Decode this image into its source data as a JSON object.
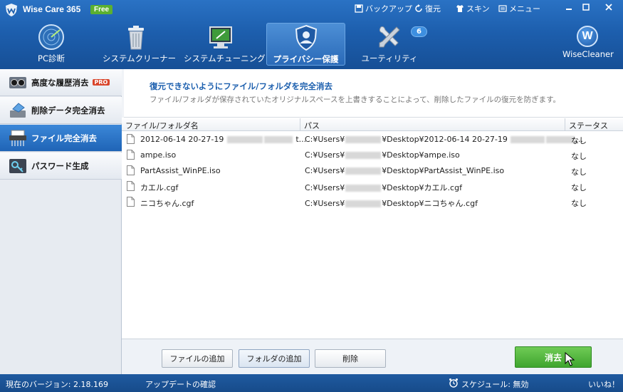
{
  "app": {
    "title": "Wise Care 365",
    "badge": "Free"
  },
  "top_menu": {
    "backup": "バックアップ",
    "restore": "復元",
    "skin": "スキン",
    "menu": "メニュー"
  },
  "nav": {
    "tabs": [
      {
        "label": "PC診断"
      },
      {
        "label": "システムクリーナー"
      },
      {
        "label": "システムチューニング"
      },
      {
        "label": "プライバシー保護"
      },
      {
        "label": "ユーティリティ"
      }
    ],
    "utility_badge": "6",
    "brand": {
      "letter": "W",
      "label": "WiseCleaner"
    }
  },
  "sidebar": {
    "items": [
      {
        "label": "高度な履歴消去",
        "badge": "PRO"
      },
      {
        "label": "削除データ完全消去"
      },
      {
        "label": "ファイル完全消去"
      },
      {
        "label": "パスワード生成"
      }
    ]
  },
  "main": {
    "title": "復元できないようにファイル/フォルダを完全消去",
    "description": "ファイル/フォルダが保存されていたオリジナルスペースを上書きすることによって、削除したファイルの復元を防ぎます。",
    "columns": {
      "name": "ファイル/フォルダ名",
      "path": "パス",
      "status": "ステータス"
    },
    "rows": [
      {
        "name": "2012-06-14 20-27-19",
        "name_suffix": "t...",
        "path_prefix": "C:¥Users¥",
        "path_suffix": "¥Desktop¥2012-06-14 20-27-19",
        "path_tail": "...",
        "status": "なし"
      },
      {
        "name": "ampe.iso",
        "name_suffix": "",
        "path_prefix": "C:¥Users¥",
        "path_suffix": "¥Desktop¥ampe.iso",
        "path_tail": "",
        "status": "なし"
      },
      {
        "name": "PartAssist_WinPE.iso",
        "name_suffix": "",
        "path_prefix": "C:¥Users¥",
        "path_suffix": "¥Desktop¥PartAssist_WinPE.iso",
        "path_tail": "",
        "status": "なし"
      },
      {
        "name": "カエル.cgf",
        "name_suffix": "",
        "path_prefix": "C:¥Users¥",
        "path_suffix": "¥Desktop¥カエル.cgf",
        "path_tail": "",
        "status": "なし"
      },
      {
        "name": "ニコちゃん.cgf",
        "name_suffix": "",
        "path_prefix": "C:¥Users¥",
        "path_suffix": "¥Desktop¥ニコちゃん.cgf",
        "path_tail": "",
        "status": "なし"
      }
    ],
    "buttons": {
      "add_file": "ファイルの追加",
      "add_folder": "フォルダの追加",
      "delete": "削除",
      "erase": "消去"
    }
  },
  "status": {
    "version": "現在のバージョン: 2.18.169",
    "update": "アップデートの確認",
    "schedule": "スケジュール: 無効",
    "like": "いいね！"
  },
  "colors": {
    "accent": "#1d5fae",
    "erase_green": "#4cb33a",
    "pro_red": "#d9452b"
  }
}
